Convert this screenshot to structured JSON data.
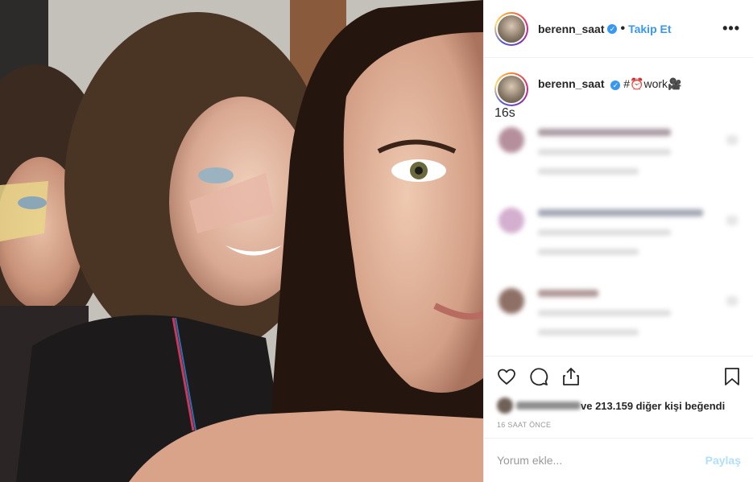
{
  "post": {
    "username": "berenn_saat",
    "verified_mark": "✓",
    "separator": "•",
    "follow_label": "Takip Et",
    "more_label": "•••"
  },
  "caption": {
    "username": "berenn_saat",
    "text": "#⏰work🎥",
    "time": "16s"
  },
  "comments_hidden": 3,
  "actions": {
    "icons": [
      "heart-icon",
      "comment-icon",
      "share-icon",
      "bookmark-icon"
    ],
    "likes_text": "ve 213.159 diğer kişi beğendi",
    "posted_ago": "16 SAAT ÖNCE"
  },
  "add_comment": {
    "placeholder": "Yorum ekle...",
    "post_label": "Paylaş"
  },
  "colors": {
    "accent": "#3897f0",
    "post_disabled": "#b2dffc",
    "muted": "#999999",
    "border": "#efefef"
  }
}
